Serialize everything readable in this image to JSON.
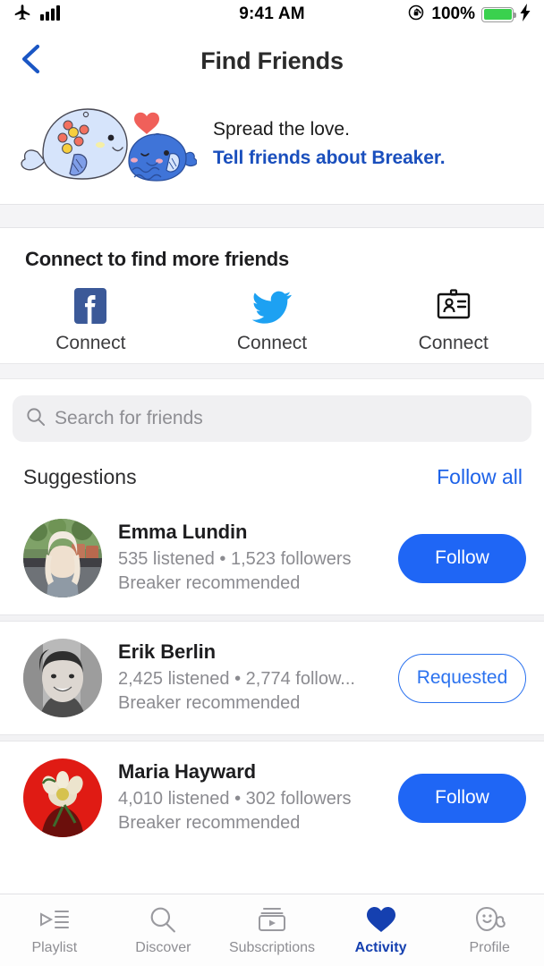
{
  "status_bar": {
    "airplane_icon": "airplane-mode-icon",
    "signal_icon": "cellular-signal-icon",
    "time": "9:41 AM",
    "rotation_lock_icon": "rotation-lock-icon",
    "battery_percent": "100%",
    "battery_icon": "battery-full-icon",
    "charging_icon": "charging-bolt-icon"
  },
  "navbar": {
    "back_icon": "back-chevron-icon",
    "title": "Find Friends"
  },
  "promo": {
    "illustration": "whales-with-heart-illustration",
    "line1": "Spread the love.",
    "line2": "Tell friends about Breaker.",
    "link_color": "#1a4fbd"
  },
  "connect": {
    "title": "Connect to find more friends",
    "items": [
      {
        "icon": "facebook-icon",
        "label": "Connect",
        "color": "#3b5998"
      },
      {
        "icon": "twitter-icon",
        "label": "Connect",
        "color": "#1da1f2"
      },
      {
        "icon": "contacts-card-icon",
        "label": "Connect",
        "color": "#111111"
      }
    ]
  },
  "search": {
    "icon": "search-icon",
    "placeholder": "Search for friends",
    "value": ""
  },
  "suggestions": {
    "title": "Suggestions",
    "follow_all_label": "Follow all",
    "accent_color": "#1d62e8",
    "users": [
      {
        "name": "Emma Lundin",
        "stats": "535 listened • 1,523 followers",
        "recommended": "Breaker recommended",
        "action_label": "Follow",
        "action_state": "follow",
        "avatar": "emma-lundin-avatar"
      },
      {
        "name": "Erik Berlin",
        "stats": "2,425 listened • 2,774 follow...",
        "recommended": "Breaker recommended",
        "action_label": "Requested",
        "action_state": "requested",
        "avatar": "erik-berlin-avatar"
      },
      {
        "name": "Maria Hayward",
        "stats": "4,010 listened • 302 followers",
        "recommended": "Breaker recommended",
        "action_label": "Follow",
        "action_state": "follow",
        "avatar": "maria-hayward-avatar"
      }
    ]
  },
  "tabbar": {
    "active_color": "#1540b0",
    "inactive_color": "#8e8e93",
    "tabs": [
      {
        "label": "Playlist",
        "icon": "playlist-queue-icon",
        "active": false
      },
      {
        "label": "Discover",
        "icon": "search-icon",
        "active": false
      },
      {
        "label": "Subscriptions",
        "icon": "subscriptions-box-icon",
        "active": false
      },
      {
        "label": "Activity",
        "icon": "heart-filled-icon",
        "active": true
      },
      {
        "label": "Profile",
        "icon": "whale-face-icon",
        "active": false
      }
    ]
  }
}
